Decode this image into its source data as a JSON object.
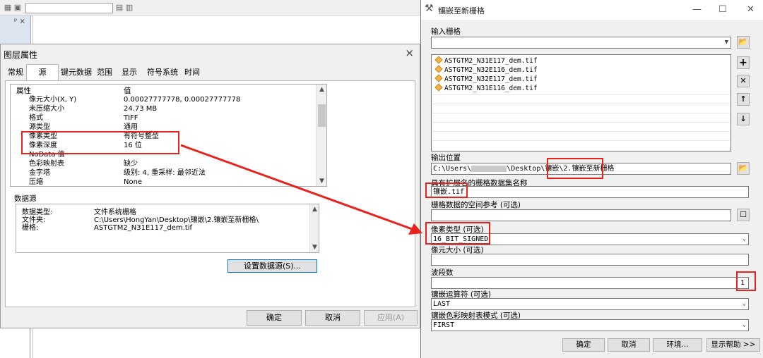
{
  "background": {
    "pin_label": "p ×"
  },
  "layer_props": {
    "title": "图层属性",
    "close": "×",
    "tabs": [
      "常规",
      "源",
      "键元数据",
      "范围",
      "显示",
      "符号系统",
      "时间"
    ],
    "table_header": {
      "key": "属性",
      "value": "值"
    },
    "rows": [
      {
        "k": "像元大小(X, Y)",
        "v": "0.00027777778, 0.00027777778"
      },
      {
        "k": "未压缩大小",
        "v": "24.73 MB"
      },
      {
        "k": "格式",
        "v": "TIFF"
      },
      {
        "k": "源类型",
        "v": "通用"
      },
      {
        "k": "像素类型",
        "v": "有符号整型"
      },
      {
        "k": "像素深度",
        "v": "16 位"
      },
      {
        "k": "NoData 值",
        "v": ""
      },
      {
        "k": "色彩映射表",
        "v": "缺少"
      },
      {
        "k": "金字塔",
        "v": "级别: 4, 重采样: 最邻近法"
      },
      {
        "k": "压缩",
        "v": "None"
      }
    ],
    "datasource_label": "数据源",
    "datasource": [
      {
        "k": "数据类型:",
        "v": "文件系统栅格"
      },
      {
        "k": "文件夹:",
        "v": "C:\\Users\\HongYan\\Desktop\\镶嵌\\2.镶嵌至新栅格\\"
      },
      {
        "k": "栅格:",
        "v": "ASTGTM2_N31E117_dem.tif"
      }
    ],
    "set_source_btn": "设置数据源(S)...",
    "ok": "确定",
    "cancel": "取消",
    "apply": "应用(A)"
  },
  "mosaic": {
    "title": "镶嵌至新栅格",
    "win_min": "—",
    "win_max": "☐",
    "win_close": "✕",
    "input_label": "输入栅格",
    "input_items": [
      "ASTGTM2_N31E117_dem.tif",
      "ASTGTM2_N32E116_dem.tif",
      "ASTGTM2_N32E117_dem.tif",
      "ASTGTM2_N31E116_dem.tif"
    ],
    "output_loc_label": "输出位置",
    "output_loc_prefix": "C:\\Users\\",
    "output_loc_mid": "\\Desktop\\镶嵌\\",
    "output_loc_tail": "2.镶嵌至新栅格",
    "dataset_name_label": "具有扩展名的栅格数据集名称",
    "dataset_name": "镶嵌.tif",
    "spatial_ref_label": "栅格数据的空间参考 (可选)",
    "pixel_type_label": "像素类型 (可选)",
    "pixel_type": "16_BIT_SIGNED",
    "cellsize_label": "像元大小 (可选)",
    "bands_label": "波段数",
    "bands": "1",
    "mosaic_op_label": "镶嵌运算符 (可选)",
    "mosaic_op": "LAST",
    "colormap_label": "镶嵌色彩映射表模式 (可选)",
    "colormap": "FIRST",
    "ok": "确定",
    "cancel": "取消",
    "env": "环境...",
    "help": "显示帮助 >>"
  }
}
